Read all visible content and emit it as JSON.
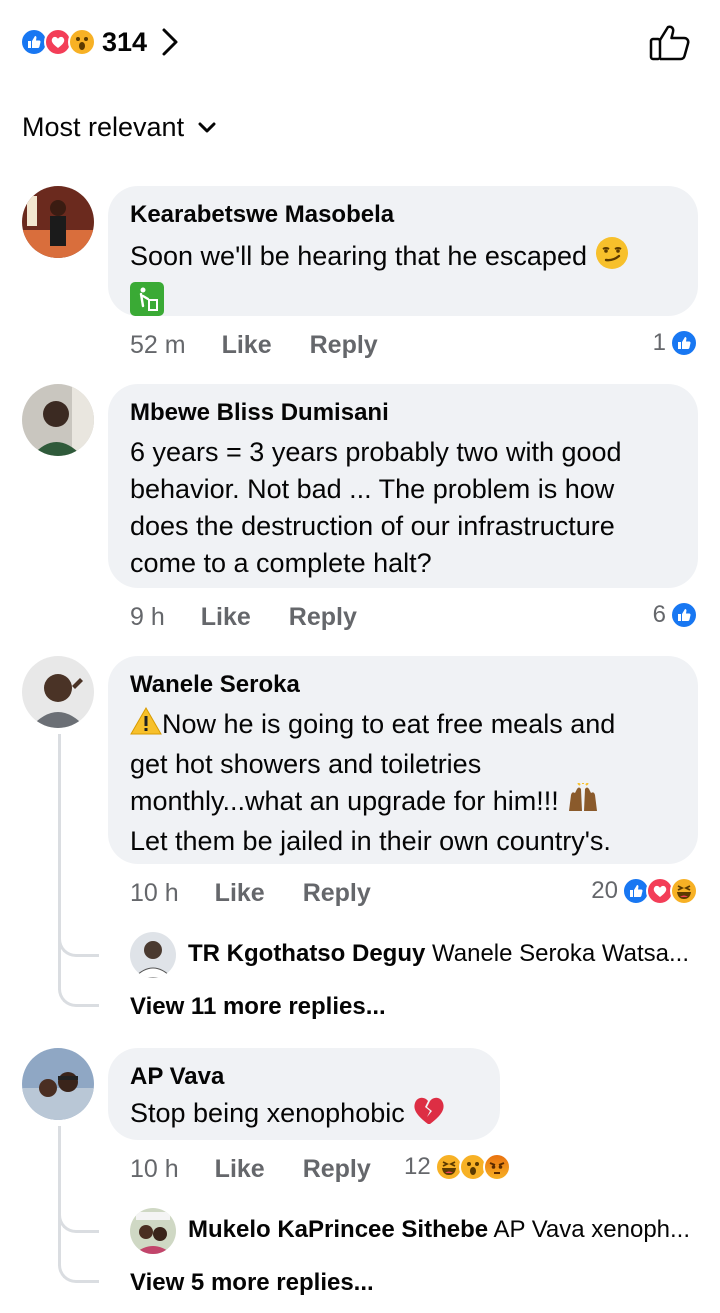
{
  "header": {
    "reaction_total": "314",
    "reaction_icons": [
      "like",
      "love",
      "wow"
    ],
    "chevron_icon": "chevron-right-icon",
    "like_icon": "thumbs-up-outline-icon"
  },
  "sort": {
    "label": "Most relevant",
    "icon": "chevron-down-icon"
  },
  "actions": {
    "like": "Like",
    "reply": "Reply"
  },
  "comments": [
    {
      "author": "Kearabetswe Masobela",
      "text": "Soon we'll be hearing that he escaped",
      "emojis": [
        "smirking-face",
        "litter-bin-sign"
      ],
      "time": "52 m",
      "reaction_count": "1",
      "reactions": [
        "like"
      ]
    },
    {
      "author": "Mbewe Bliss Dumisani",
      "lines": [
        "6 years = 3 years probably two with good",
        "behavior. Not bad ... The problem is how",
        "does the destruction of our infrastructure",
        "come to a complete halt?"
      ],
      "time": "9 h",
      "reaction_count": "6",
      "reactions": [
        "like"
      ]
    },
    {
      "author": "Wanele Seroka",
      "lines": [
        "Now he is going to eat free meals and",
        "get hot showers and toiletries",
        "monthly...what an upgrade for him!!!",
        "Let them be jailed in their own country's."
      ],
      "emojis": [
        "warning-sign",
        "raising-hands"
      ],
      "time": "10 h",
      "reaction_count": "20",
      "reactions": [
        "like",
        "love",
        "haha"
      ],
      "reply_preview": {
        "author": "TR Kgothatso Deguy",
        "text": "Wanele Seroka Watsa..."
      },
      "view_more": "View 11 more replies..."
    },
    {
      "author": "AP Vava",
      "text": "Stop being xenophobic",
      "emojis": [
        "broken-heart"
      ],
      "time": "10 h",
      "reaction_count": "12",
      "reactions": [
        "haha",
        "wow",
        "angry"
      ],
      "reply_preview": {
        "author": "Mukelo KaPrincee Sithebe",
        "text": "AP Vava xenoph..."
      },
      "view_more": "View 5 more replies..."
    }
  ]
}
